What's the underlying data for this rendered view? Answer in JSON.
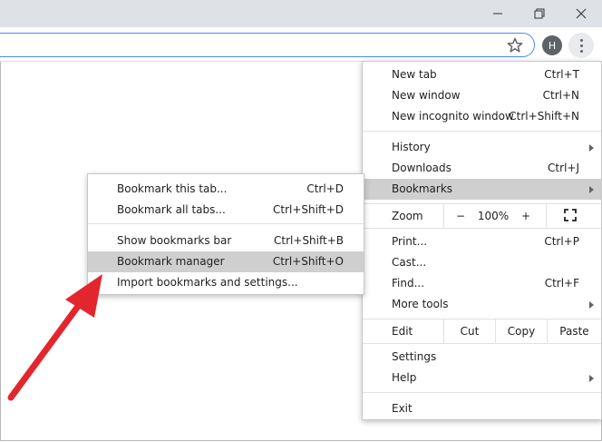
{
  "colors": {
    "highlight": "#cfcfcf",
    "arrow": "#e3262d",
    "titlebar": "#dee1e6",
    "omnibox_border": "#4a8af4"
  },
  "window_controls": [
    "minimize-icon",
    "restore-icon",
    "close-icon"
  ],
  "toolbar": {
    "avatar_letter": "H",
    "bookmark_star": "star-icon",
    "menu_button": "kebab-menu-icon"
  },
  "menu": {
    "new_tab": {
      "label": "New tab",
      "shortcut": "Ctrl+T"
    },
    "new_window": {
      "label": "New window",
      "shortcut": "Ctrl+N"
    },
    "new_incognito": {
      "label": "New incognito window",
      "shortcut": "Ctrl+Shift+N"
    },
    "history": {
      "label": "History"
    },
    "downloads": {
      "label": "Downloads",
      "shortcut": "Ctrl+J"
    },
    "bookmarks": {
      "label": "Bookmarks"
    },
    "zoom": {
      "label": "Zoom",
      "minus": "−",
      "value": "100%",
      "plus": "+"
    },
    "print": {
      "label": "Print...",
      "shortcut": "Ctrl+P"
    },
    "cast": {
      "label": "Cast..."
    },
    "find": {
      "label": "Find...",
      "shortcut": "Ctrl+F"
    },
    "more_tools": {
      "label": "More tools"
    },
    "edit": {
      "label": "Edit",
      "cut": "Cut",
      "copy": "Copy",
      "paste": "Paste"
    },
    "settings": {
      "label": "Settings"
    },
    "help": {
      "label": "Help"
    },
    "exit": {
      "label": "Exit"
    }
  },
  "submenu": {
    "bookmark_tab": {
      "label": "Bookmark this tab...",
      "shortcut": "Ctrl+D"
    },
    "bookmark_all": {
      "label": "Bookmark all tabs...",
      "shortcut": "Ctrl+Shift+D"
    },
    "show_bar": {
      "label": "Show bookmarks bar",
      "shortcut": "Ctrl+Shift+B"
    },
    "manager": {
      "label": "Bookmark manager",
      "shortcut": "Ctrl+Shift+O"
    },
    "import": {
      "label": "Import bookmarks and settings..."
    }
  }
}
